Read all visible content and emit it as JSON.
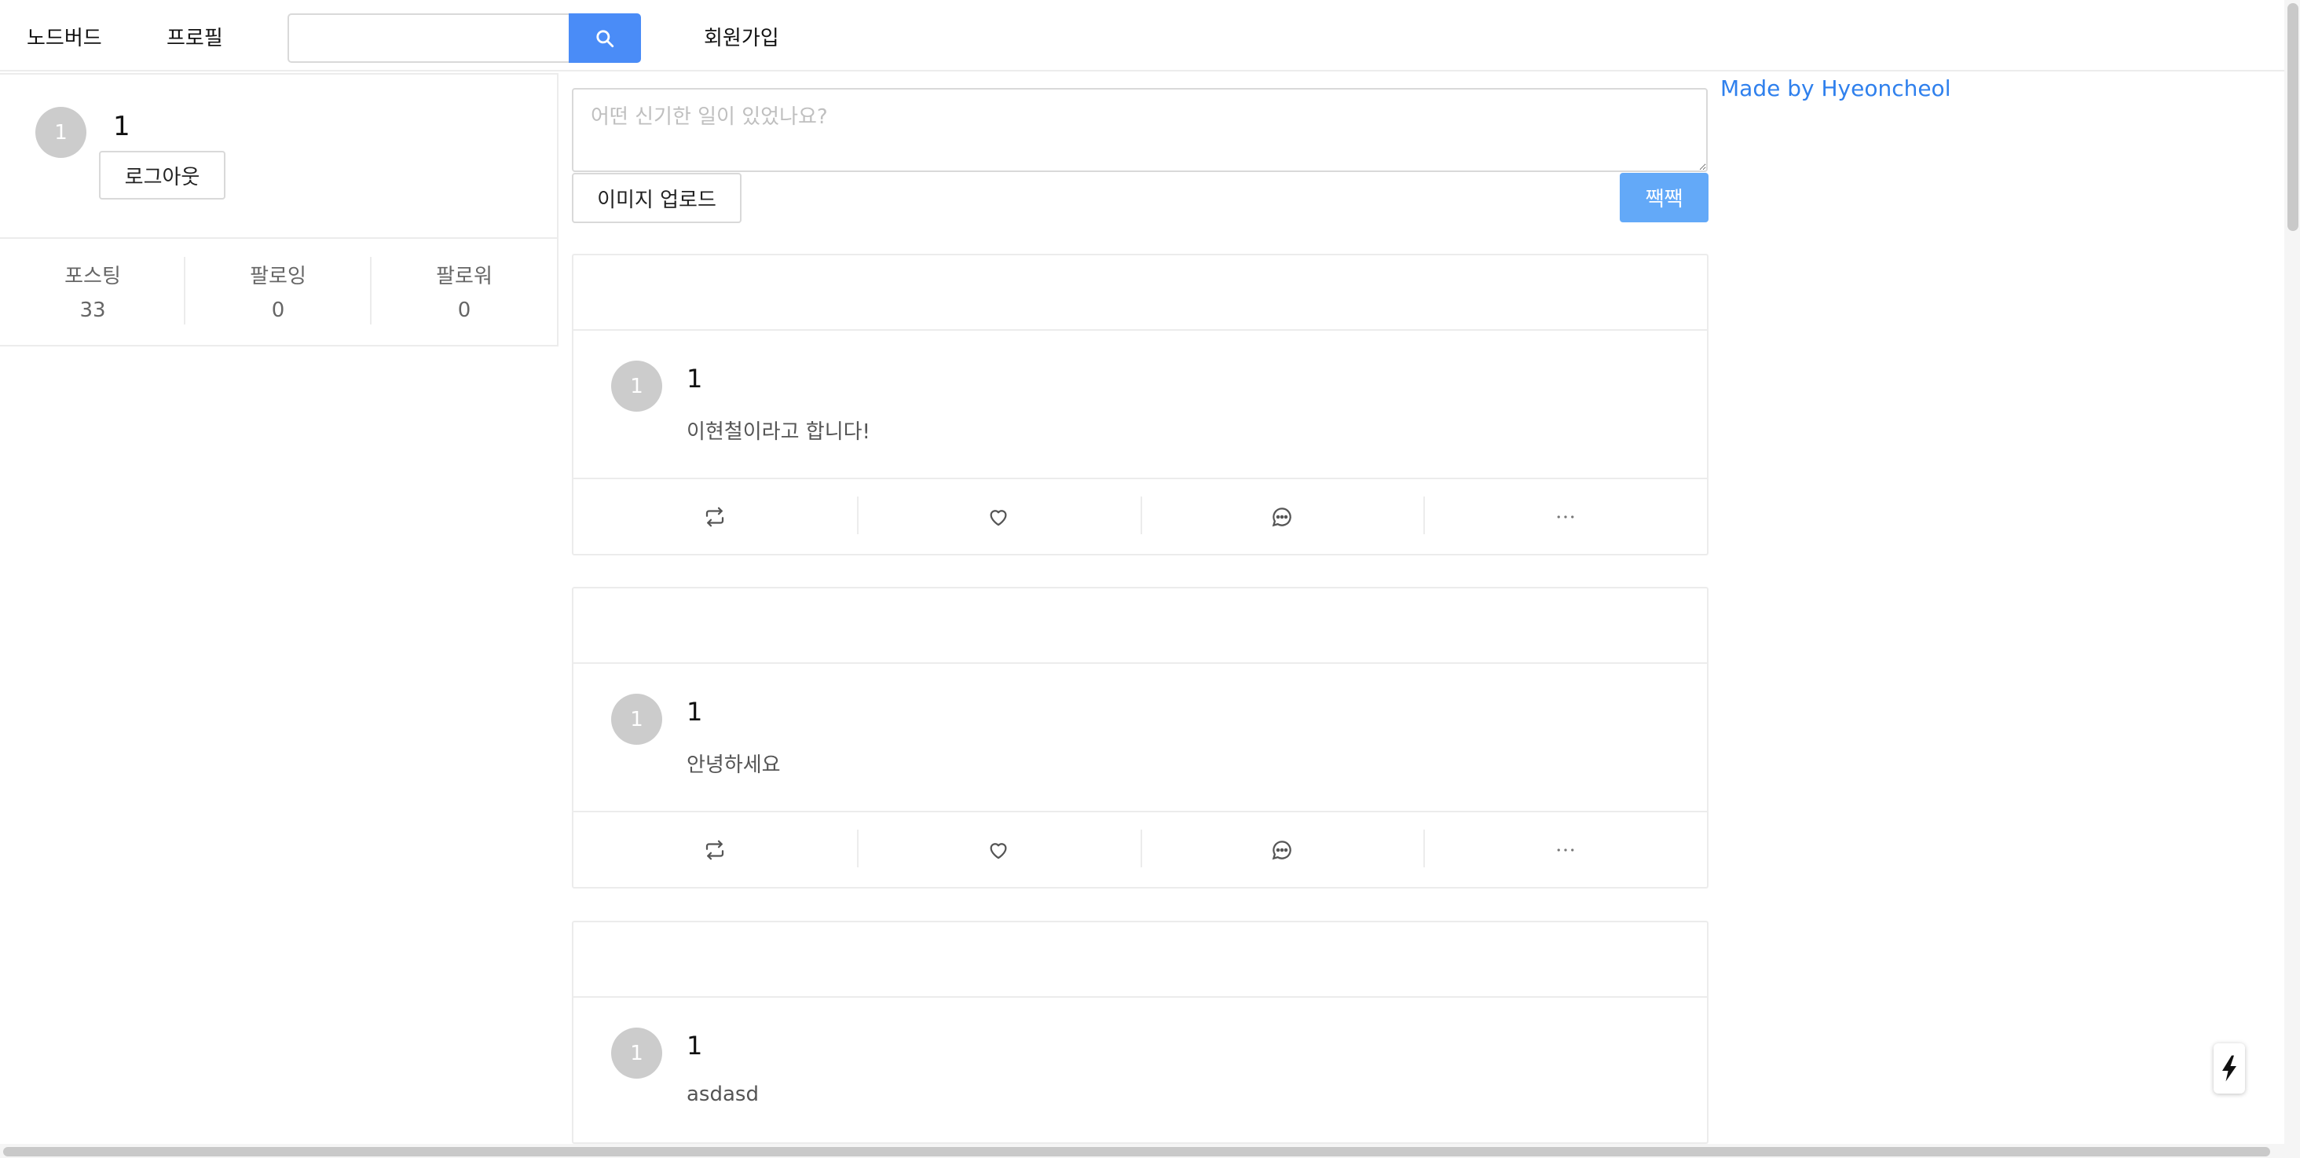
{
  "header": {
    "nav_home": "노드버드",
    "nav_profile": "프로필",
    "search_value": "",
    "search_icon": "search-icon",
    "nav_signup": "회원가입"
  },
  "profile": {
    "avatar_initial": "1",
    "name": "1",
    "logout_label": "로그아웃",
    "stats": [
      {
        "label": "포스팅",
        "value": "33"
      },
      {
        "label": "팔로잉",
        "value": "0"
      },
      {
        "label": "팔로워",
        "value": "0"
      }
    ]
  },
  "composer": {
    "placeholder": "어떤 신기한 일이 있었나요?",
    "upload_label": "이미지 업로드",
    "submit_label": "짹짹"
  },
  "credit": "Made by Hyeoncheol",
  "posts": [
    {
      "avatar_initial": "1",
      "author": "1",
      "content": "이현철이라고 합니다!"
    },
    {
      "avatar_initial": "1",
      "author": "1",
      "content": "안녕하세요"
    },
    {
      "avatar_initial": "1",
      "author": "1",
      "content": "asdasd"
    }
  ],
  "post_actions": [
    "retweet-icon",
    "heart-icon",
    "comment-icon",
    "ellipsis-icon"
  ],
  "colors": {
    "primary": "#4a8cf7",
    "submit": "#63a9f8",
    "link": "#2f80ed",
    "avatar": "#cccccc",
    "border": "#ececec"
  }
}
